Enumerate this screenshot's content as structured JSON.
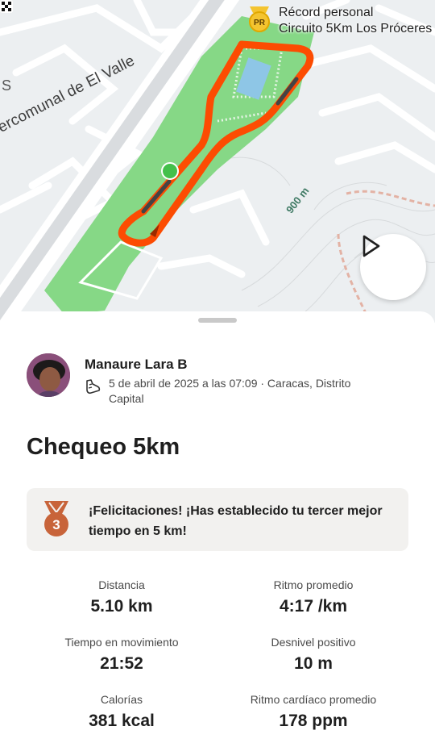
{
  "map": {
    "street_label": "ercomunal de El Valle",
    "corner_label": "S",
    "elevation_label": "900 m",
    "pr_badge_text": "PR",
    "segment_title": "Récord personal",
    "segment_name": "Circuito 5Km Los Próceres"
  },
  "activity": {
    "athlete_name": "Manaure Lara B",
    "date_location": "5 de abril de 2025 a las 07:09 · Caracas, Distrito Capital",
    "title": "Chequeo 5km"
  },
  "achievement": {
    "medal_number": "3",
    "message": "¡Felicitaciones! ¡Has establecido tu tercer mejor tiempo en 5 km!"
  },
  "stats": [
    {
      "label": "Distancia",
      "value": "5.10 km"
    },
    {
      "label": "Ritmo promedio",
      "value": "4:17 /km"
    },
    {
      "label": "Tiempo en movimiento",
      "value": "21:52"
    },
    {
      "label": "Desnivel positivo",
      "value": "10 m"
    },
    {
      "label": "Calorías",
      "value": "381 kcal"
    },
    {
      "label": "Ritmo cardíaco promedio",
      "value": "178 ppm"
    }
  ],
  "colors": {
    "route": "#fc4c02",
    "park": "#86d886",
    "pr_badge": "#f4c430",
    "medal": "#c8643a"
  }
}
